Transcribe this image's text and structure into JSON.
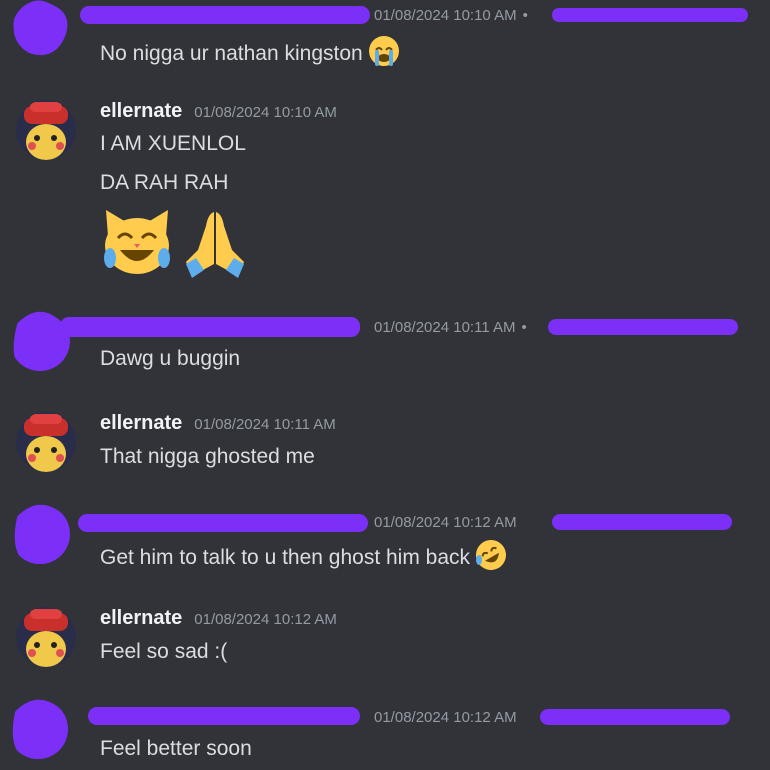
{
  "colors": {
    "background": "#313338",
    "username": "#f2f3f5",
    "timestamp": "#949ba4",
    "text": "#dbdee1",
    "redaction": "#7b2ff7"
  },
  "messages": [
    {
      "redacted_author": true,
      "timestamp": "01/08/2024 10:10 AM",
      "separator": "•",
      "lines": [
        "No nigga ur nathan kingston"
      ],
      "inline_emoji": "loudly-crying-face"
    },
    {
      "author": "ellernate",
      "timestamp": "01/08/2024 10:10 AM",
      "lines": [
        "I AM XUENLOL",
        "DA RAH RAH"
      ],
      "big_emojis": [
        "cat-with-tears-of-joy",
        "folded-hands"
      ]
    },
    {
      "redacted_author": true,
      "timestamp": "01/08/2024 10:11 AM",
      "separator": "•",
      "lines": [
        "Dawg u buggin"
      ]
    },
    {
      "author": "ellernate",
      "timestamp": "01/08/2024 10:11 AM",
      "lines": [
        "That nigga ghosted me"
      ]
    },
    {
      "redacted_author": true,
      "timestamp": "01/08/2024 10:12 AM",
      "lines": [
        "Get him to talk to u then ghost him back"
      ],
      "inline_emoji": "rolling-on-the-floor-laughing"
    },
    {
      "author": "ellernate",
      "timestamp": "01/08/2024 10:12 AM",
      "lines": [
        "Feel so sad :("
      ]
    },
    {
      "redacted_author": true,
      "timestamp": "01/08/2024 10:12 AM",
      "lines": [
        "Feel better soon"
      ]
    }
  ]
}
